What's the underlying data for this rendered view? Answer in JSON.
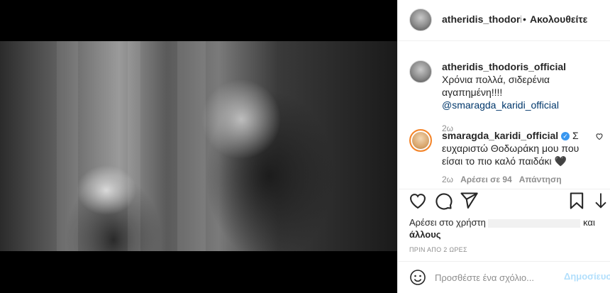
{
  "header": {
    "username": "atheridis_thodoris_c",
    "separator": "•",
    "follow_label": "Ακολουθείτε"
  },
  "comments": [
    {
      "username": "atheridis_thodoris_official",
      "text": "Χρόνια πολλά, σιδερένια αγαπημένη!!!!",
      "mention": "@smaragda_karidi_official",
      "time": "2ω"
    },
    {
      "username": "smaragda_karidi_official",
      "verified": true,
      "text": "Σ ευχαριστώ Θοδωράκη μου που είσαι το πιο καλό παιδάκι 🖤",
      "time": "2ω",
      "likes": "Αρέσει σε 94",
      "reply": "Απάντηση"
    }
  ],
  "actions": {
    "like_icon": "heart-icon",
    "comment_icon": "comment-icon",
    "share_icon": "share-icon",
    "save_icon": "bookmark-icon"
  },
  "likes": {
    "prefix": "Αρέσει στο χρήστη",
    "suffix": "και",
    "others": "άλλους"
  },
  "timestamp": "ΠΡΙΝ ΑΠΟ 2 ΩΡΕΣ",
  "composer": {
    "placeholder": "Προσθέστε ένα σχόλιο...",
    "post_label": "Δημοσίευση"
  },
  "colors": {
    "link": "#00376b",
    "post_disabled": "#b2dffc",
    "verified": "#3897f0"
  }
}
